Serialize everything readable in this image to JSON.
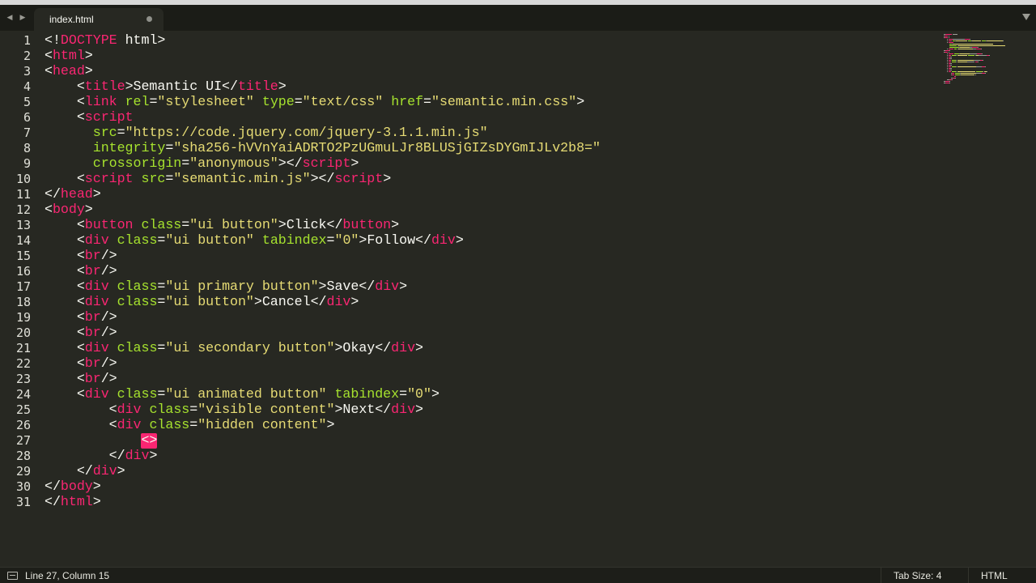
{
  "tab": {
    "title": "index.html",
    "modified": true
  },
  "gutter": {
    "line_numbers": [
      "1",
      "2",
      "3",
      "4",
      "5",
      "6",
      "7",
      "8",
      "9",
      "10",
      "11",
      "12",
      "13",
      "14",
      "15",
      "16",
      "17",
      "18",
      "19",
      "20",
      "21",
      "22",
      "23",
      "24",
      "25",
      "26",
      "27",
      "28",
      "29",
      "30",
      "31"
    ]
  },
  "editor": {
    "cursor_line": 27,
    "lines": [
      [
        [
          "p",
          "<!"
        ],
        [
          "t",
          "DOCTYPE"
        ],
        [
          "p",
          " html>"
        ]
      ],
      [
        [
          "p",
          "<"
        ],
        [
          "t",
          "html"
        ],
        [
          "p",
          ">"
        ]
      ],
      [
        [
          "p",
          "<"
        ],
        [
          "t",
          "head"
        ],
        [
          "p",
          ">"
        ]
      ],
      [
        [
          "p",
          "    <"
        ],
        [
          "t",
          "title"
        ],
        [
          "p",
          ">Semantic UI</"
        ],
        [
          "t",
          "title"
        ],
        [
          "p",
          ">"
        ]
      ],
      [
        [
          "p",
          "    <"
        ],
        [
          "t",
          "link"
        ],
        [
          "p",
          " "
        ],
        [
          "a",
          "rel"
        ],
        [
          "p",
          "="
        ],
        [
          "s",
          "\"stylesheet\""
        ],
        [
          "p",
          " "
        ],
        [
          "a",
          "type"
        ],
        [
          "p",
          "="
        ],
        [
          "s",
          "\"text/css\""
        ],
        [
          "p",
          " "
        ],
        [
          "a",
          "href"
        ],
        [
          "p",
          "="
        ],
        [
          "s",
          "\"semantic.min.css\""
        ],
        [
          "p",
          ">"
        ]
      ],
      [
        [
          "p",
          "    <"
        ],
        [
          "t",
          "script"
        ]
      ],
      [
        [
          "p",
          "      "
        ],
        [
          "a",
          "src"
        ],
        [
          "p",
          "="
        ],
        [
          "s",
          "\"https://code.jquery.com/jquery-3.1.1.min.js\""
        ]
      ],
      [
        [
          "p",
          "      "
        ],
        [
          "a",
          "integrity"
        ],
        [
          "p",
          "="
        ],
        [
          "s",
          "\"sha256-hVVnYaiADRTO2PzUGmuLJr8BLUSjGIZsDYGmIJLv2b8=\""
        ]
      ],
      [
        [
          "p",
          "      "
        ],
        [
          "a",
          "crossorigin"
        ],
        [
          "p",
          "="
        ],
        [
          "s",
          "\"anonymous\""
        ],
        [
          "p",
          "></"
        ],
        [
          "t",
          "script"
        ],
        [
          "p",
          ">"
        ]
      ],
      [
        [
          "p",
          "    <"
        ],
        [
          "t",
          "script"
        ],
        [
          "p",
          " "
        ],
        [
          "a",
          "src"
        ],
        [
          "p",
          "="
        ],
        [
          "s",
          "\"semantic.min.js\""
        ],
        [
          "p",
          "></"
        ],
        [
          "t",
          "script"
        ],
        [
          "p",
          ">"
        ]
      ],
      [
        [
          "p",
          "</"
        ],
        [
          "t",
          "head"
        ],
        [
          "p",
          ">"
        ]
      ],
      [
        [
          "p",
          "<"
        ],
        [
          "t",
          "body"
        ],
        [
          "p",
          ">"
        ]
      ],
      [
        [
          "p",
          "    <"
        ],
        [
          "t",
          "button"
        ],
        [
          "p",
          " "
        ],
        [
          "a",
          "class"
        ],
        [
          "p",
          "="
        ],
        [
          "s",
          "\"ui button\""
        ],
        [
          "p",
          ">Click</"
        ],
        [
          "t",
          "button"
        ],
        [
          "p",
          ">"
        ]
      ],
      [
        [
          "p",
          "    <"
        ],
        [
          "t",
          "div"
        ],
        [
          "p",
          " "
        ],
        [
          "a",
          "class"
        ],
        [
          "p",
          "="
        ],
        [
          "s",
          "\"ui button\""
        ],
        [
          "p",
          " "
        ],
        [
          "a",
          "tabindex"
        ],
        [
          "p",
          "="
        ],
        [
          "s",
          "\"0\""
        ],
        [
          "p",
          ">Follow</"
        ],
        [
          "t",
          "div"
        ],
        [
          "p",
          ">"
        ]
      ],
      [
        [
          "p",
          "    <"
        ],
        [
          "t",
          "br"
        ],
        [
          "p",
          "/>"
        ]
      ],
      [
        [
          "p",
          "    <"
        ],
        [
          "t",
          "br"
        ],
        [
          "p",
          "/>"
        ]
      ],
      [
        [
          "p",
          "    <"
        ],
        [
          "t",
          "div"
        ],
        [
          "p",
          " "
        ],
        [
          "a",
          "class"
        ],
        [
          "p",
          "="
        ],
        [
          "s",
          "\"ui primary button\""
        ],
        [
          "p",
          ">Save</"
        ],
        [
          "t",
          "div"
        ],
        [
          "p",
          ">"
        ]
      ],
      [
        [
          "p",
          "    <"
        ],
        [
          "t",
          "div"
        ],
        [
          "p",
          " "
        ],
        [
          "a",
          "class"
        ],
        [
          "p",
          "="
        ],
        [
          "s",
          "\"ui button\""
        ],
        [
          "p",
          ">Cancel</"
        ],
        [
          "t",
          "div"
        ],
        [
          "p",
          ">"
        ]
      ],
      [
        [
          "p",
          "    <"
        ],
        [
          "t",
          "br"
        ],
        [
          "p",
          "/>"
        ]
      ],
      [
        [
          "p",
          "    <"
        ],
        [
          "t",
          "br"
        ],
        [
          "p",
          "/>"
        ]
      ],
      [
        [
          "p",
          "    <"
        ],
        [
          "t",
          "div"
        ],
        [
          "p",
          " "
        ],
        [
          "a",
          "class"
        ],
        [
          "p",
          "="
        ],
        [
          "s",
          "\"ui secondary button\""
        ],
        [
          "p",
          ">Okay</"
        ],
        [
          "t",
          "div"
        ],
        [
          "p",
          ">"
        ]
      ],
      [
        [
          "p",
          "    <"
        ],
        [
          "t",
          "br"
        ],
        [
          "p",
          "/>"
        ]
      ],
      [
        [
          "p",
          "    <"
        ],
        [
          "t",
          "br"
        ],
        [
          "p",
          "/>"
        ]
      ],
      [
        [
          "p",
          "    <"
        ],
        [
          "t",
          "div"
        ],
        [
          "p",
          " "
        ],
        [
          "a",
          "class"
        ],
        [
          "p",
          "="
        ],
        [
          "s",
          "\"ui animated button\""
        ],
        [
          "p",
          " "
        ],
        [
          "a",
          "tabindex"
        ],
        [
          "p",
          "="
        ],
        [
          "s",
          "\"0\""
        ],
        [
          "p",
          ">"
        ]
      ],
      [
        [
          "p",
          "        <"
        ],
        [
          "t",
          "div"
        ],
        [
          "p",
          " "
        ],
        [
          "a",
          "class"
        ],
        [
          "p",
          "="
        ],
        [
          "s",
          "\"visible content\""
        ],
        [
          "p",
          ">Next</"
        ],
        [
          "t",
          "div"
        ],
        [
          "p",
          ">"
        ]
      ],
      [
        [
          "p",
          "        <"
        ],
        [
          "t",
          "div"
        ],
        [
          "p",
          " "
        ],
        [
          "a",
          "class"
        ],
        [
          "p",
          "="
        ],
        [
          "s",
          "\"hidden content\""
        ],
        [
          "p",
          ">"
        ]
      ],
      [
        [
          "p",
          "            "
        ],
        [
          "cursor-tag",
          "<>"
        ]
      ],
      [
        [
          "p",
          "        </"
        ],
        [
          "t",
          "div"
        ],
        [
          "p",
          ">"
        ]
      ],
      [
        [
          "p",
          "    </"
        ],
        [
          "t",
          "div"
        ],
        [
          "p",
          ">"
        ]
      ],
      [
        [
          "p",
          "</"
        ],
        [
          "t",
          "body"
        ],
        [
          "p",
          ">"
        ]
      ],
      [
        [
          "p",
          "</"
        ],
        [
          "t",
          "html"
        ],
        [
          "p",
          ">"
        ]
      ]
    ]
  },
  "status": {
    "position": "Line 27, Column 15",
    "tab_size": "Tab Size: 4",
    "syntax": "HTML"
  },
  "colors": {
    "background": "#272822",
    "tag": "#f92672",
    "string": "#e6db74",
    "attribute": "#a6e22e",
    "text": "#f8f8f2"
  }
}
